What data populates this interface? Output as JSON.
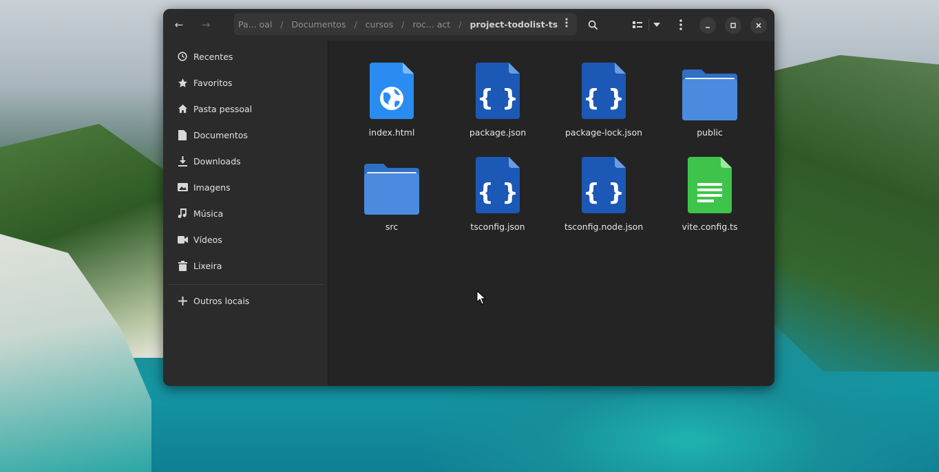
{
  "window": {
    "pathbar": {
      "crumbs": [
        "Pa... oal",
        "Documentos",
        "cursos",
        "roc... act",
        "project-todolist-ts"
      ],
      "separator": "/"
    }
  },
  "sidebar": {
    "items": [
      {
        "label": "Recentes",
        "icon": "clock-icon"
      },
      {
        "label": "Favoritos",
        "icon": "star-icon"
      },
      {
        "label": "Pasta pessoal",
        "icon": "home-icon"
      },
      {
        "label": "Documentos",
        "icon": "document-icon"
      },
      {
        "label": "Downloads",
        "icon": "download-icon"
      },
      {
        "label": "Imagens",
        "icon": "image-icon"
      },
      {
        "label": "Música",
        "icon": "music-icon"
      },
      {
        "label": "Vídeos",
        "icon": "video-icon"
      },
      {
        "label": "Lixeira",
        "icon": "trash-icon"
      }
    ],
    "other": {
      "label": "Outros locais",
      "icon": "plus-icon"
    }
  },
  "files": [
    {
      "name": "index.html",
      "type": "html"
    },
    {
      "name": "package.json",
      "type": "json"
    },
    {
      "name": "package-lock.json",
      "type": "json"
    },
    {
      "name": "public",
      "type": "folder"
    },
    {
      "name": "src",
      "type": "folder"
    },
    {
      "name": "tsconfig.json",
      "type": "json"
    },
    {
      "name": "tsconfig.node.json",
      "type": "json"
    },
    {
      "name": "vite.config.ts",
      "type": "text"
    }
  ],
  "colors": {
    "window_bg": "#242424",
    "sidebar_bg": "#2b2b2b",
    "json_icon": "#1c58b5",
    "html_icon": "#2a8cf0",
    "folder_icon": "#4a8be0",
    "text_icon": "#3ec44a"
  }
}
